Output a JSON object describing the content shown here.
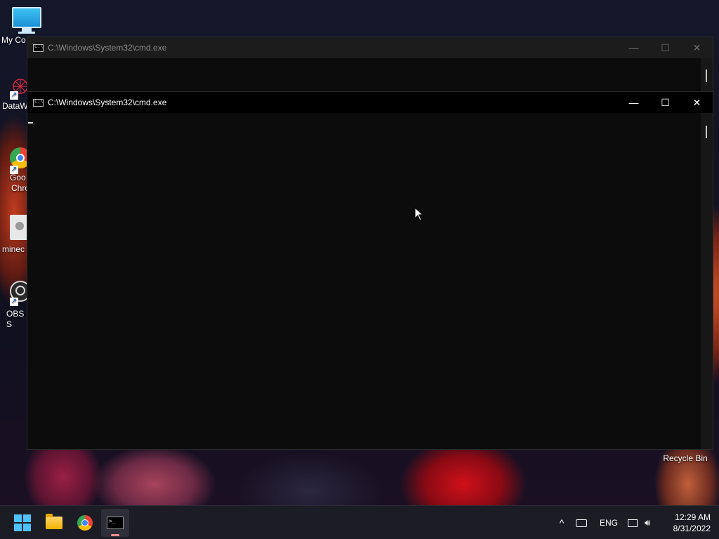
{
  "desktop": {
    "icons": [
      {
        "label": "My Co",
        "icon": "monitor-icon"
      },
      {
        "label": "DataW",
        "icon": "datawrapper-icon"
      },
      {
        "label": "Goo",
        "label2": "Chro",
        "icon": "chrome-icon"
      },
      {
        "label": "minec",
        "icon": "minecraft-file-icon"
      },
      {
        "label": "OBS S",
        "icon": "obs-icon"
      }
    ],
    "recycle_bin": "Recycle Bin"
  },
  "back_window": {
    "title": "C:\\Windows\\System32\\cmd.exe",
    "minimize": "—",
    "maximize": "☐",
    "close": "✕"
  },
  "front_window": {
    "title": "C:\\Windows\\System32\\cmd.exe",
    "minimize": "—",
    "maximize": "☐",
    "close": "✕",
    "cursor": "_"
  },
  "taskbar": {
    "apps": [
      {
        "name": "Start",
        "icon": "windows-start-icon"
      },
      {
        "name": "File Explorer",
        "icon": "folder-icon"
      },
      {
        "name": "Google Chrome",
        "icon": "chrome-icon"
      },
      {
        "name": "Command Prompt",
        "icon": "cmd-icon",
        "active": true
      }
    ],
    "tray": {
      "chevron": "^",
      "language": "ENG",
      "time": "12:29 AM",
      "date": "8/31/2022"
    }
  },
  "colors": {
    "accent": "#4cc2ff",
    "taskbar_bg": "#1c1c24",
    "terminal_bg": "#0c0c0c"
  }
}
